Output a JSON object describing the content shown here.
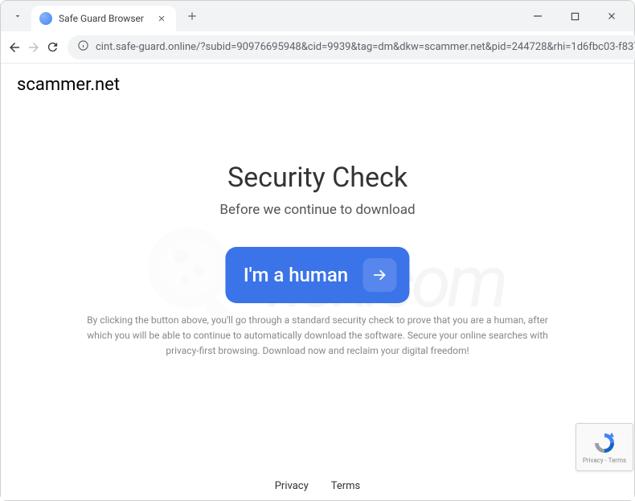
{
  "window": {
    "tab_title": "Safe Guard Browser"
  },
  "toolbar": {
    "url": "cint.safe-guard.online/?subid=90976695948&cid=9939&tag=dm&dkw=scammer.net&pid=244728&rhi=1d6fbc03-f837-..."
  },
  "page": {
    "site_label": "scammer.net",
    "heading": "Security Check",
    "subheading": "Before we continue to download",
    "cta_label": "I'm a human",
    "disclaimer": "By clicking the button above, you'll go through a standard security check to prove that you are a human, after which you will be able to continue to automatically download the software. Secure your online searches with privacy-first browsing. Download now and reclaim your digital freedom!"
  },
  "footer": {
    "privacy": "Privacy",
    "terms": "Terms"
  },
  "recaptcha": {
    "line1": "reCAPTCHA",
    "line2": "Privacy - Terms"
  },
  "watermark": {
    "text": "risk.com"
  }
}
